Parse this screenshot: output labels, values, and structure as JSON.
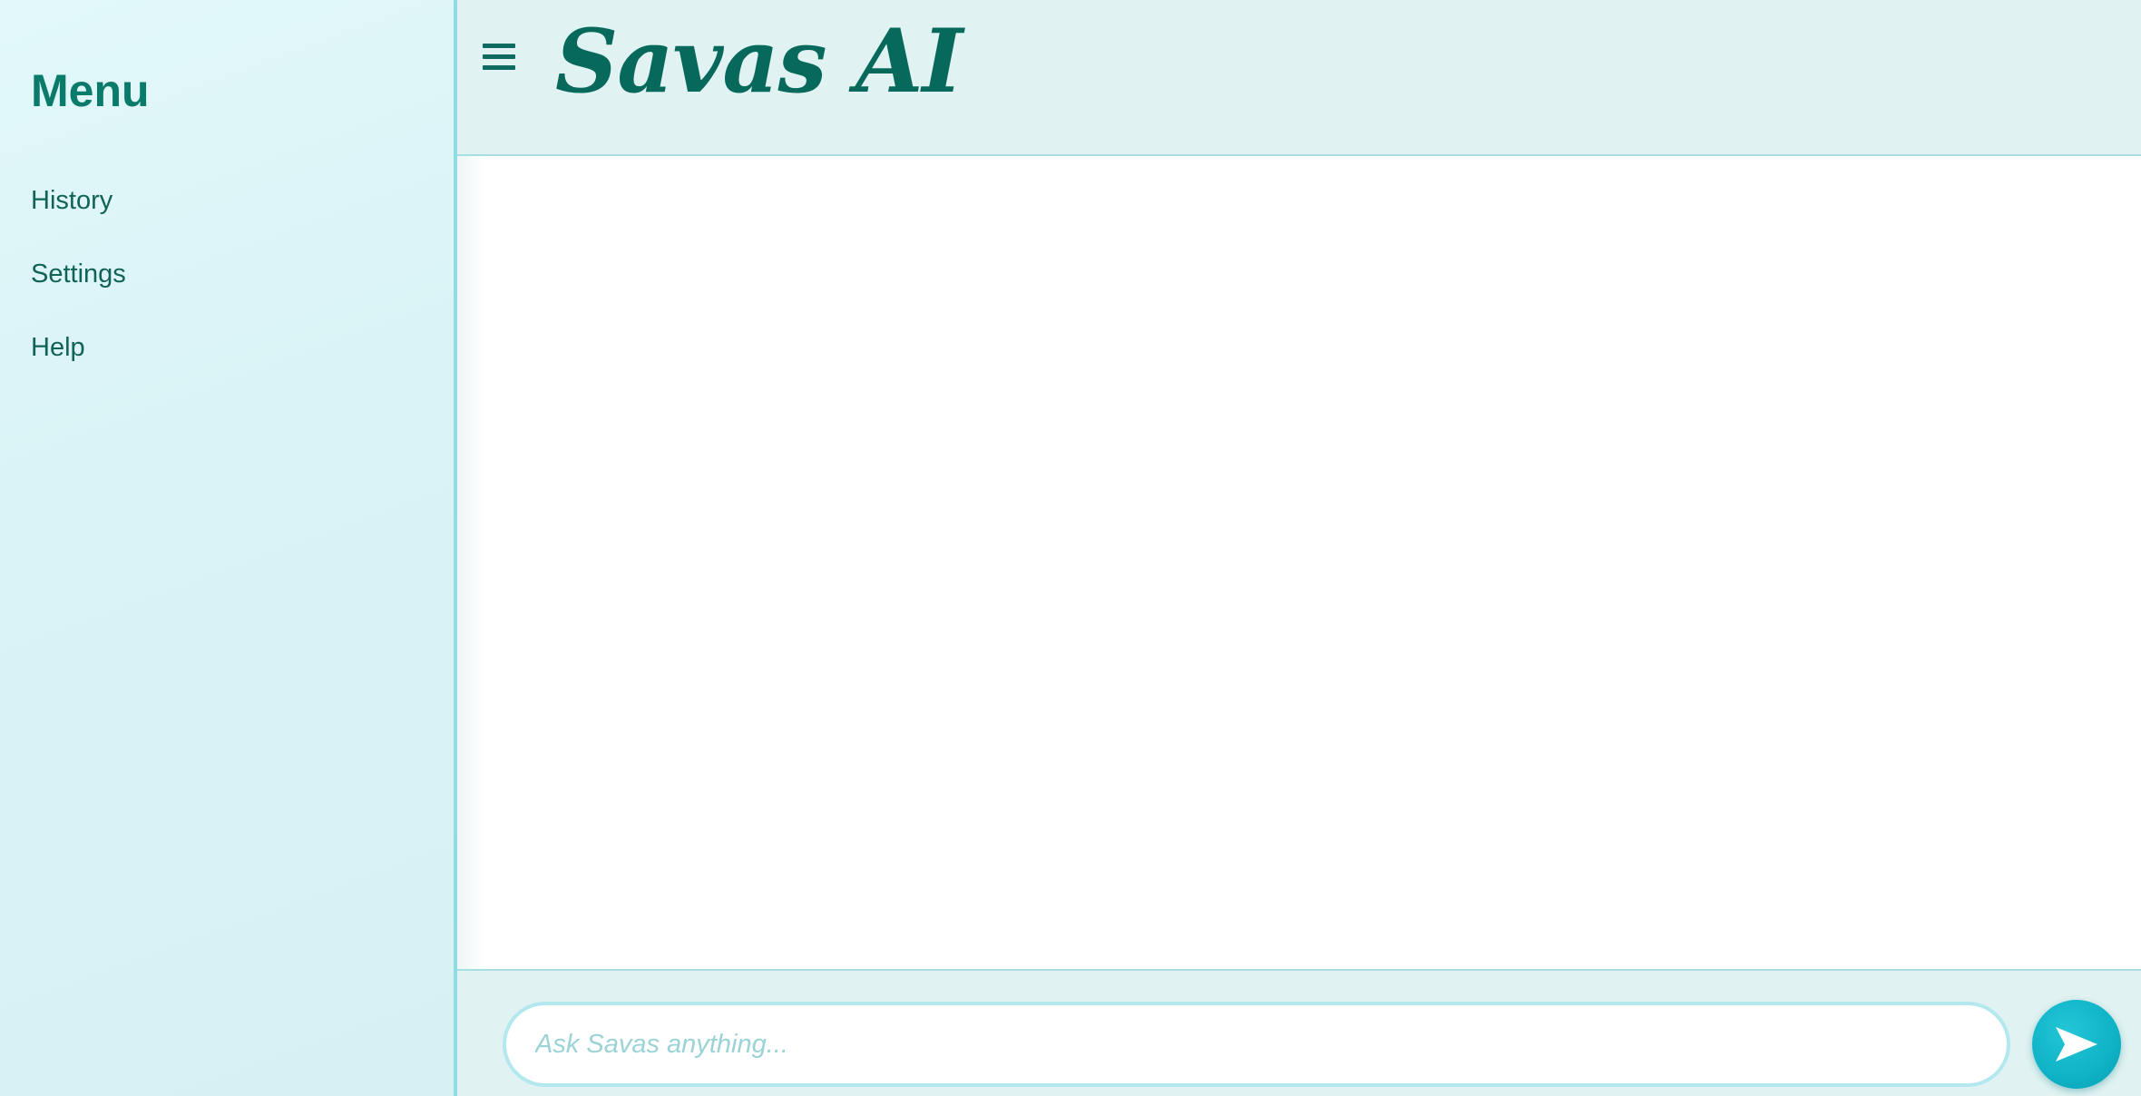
{
  "sidebar": {
    "title": "Menu",
    "items": [
      {
        "label": "History"
      },
      {
        "label": "Settings"
      },
      {
        "label": "Help"
      }
    ]
  },
  "header": {
    "menu_icon": "hamburger-menu-icon",
    "brand": "Savas AI"
  },
  "composer": {
    "placeholder": "Ask Savas anything...",
    "value": "",
    "send_icon": "paper-plane-send-icon"
  },
  "colors": {
    "accent": "#0fb2c6",
    "brand_text": "#07695b",
    "sidebar_bg": "#dff6f8",
    "header_bg": "#e0f2f1"
  }
}
